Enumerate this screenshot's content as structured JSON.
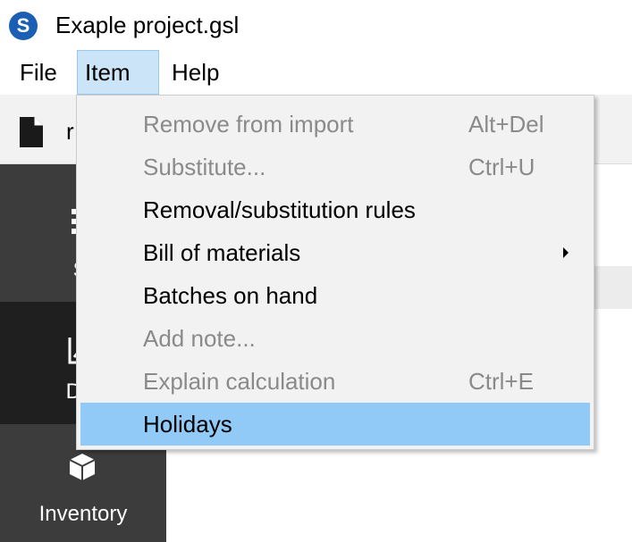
{
  "window": {
    "title": "Exaple project.gsl",
    "logo_letter": "S"
  },
  "menubar": {
    "items": [
      {
        "label": "File"
      },
      {
        "label": "Item",
        "active": true
      },
      {
        "label": "Help"
      }
    ]
  },
  "toolbar": {
    "partial_text": "r"
  },
  "sidebar": {
    "items": [
      {
        "label": "St",
        "icon": "start-icon"
      },
      {
        "label": "Der",
        "icon": "chart-icon",
        "selected": true
      },
      {
        "label": "Inventory",
        "icon": "box-icon"
      }
    ]
  },
  "dropdown": {
    "items": [
      {
        "label": "Remove from import",
        "shortcut": "Alt+Del",
        "enabled": false
      },
      {
        "label": "Substitute...",
        "shortcut": "Ctrl+U",
        "enabled": false
      },
      {
        "label": "Removal/substitution rules",
        "shortcut": "",
        "enabled": true
      },
      {
        "label": "Bill of materials",
        "shortcut": "",
        "enabled": true,
        "submenu": true
      },
      {
        "label": "Batches on hand",
        "shortcut": "",
        "enabled": true
      },
      {
        "label": "Add note...",
        "shortcut": "",
        "enabled": false
      },
      {
        "label": "Explain calculation",
        "shortcut": "Ctrl+E",
        "enabled": false
      },
      {
        "label": "Holidays",
        "shortcut": "",
        "enabled": true,
        "highlighted": true
      }
    ]
  },
  "colors": {
    "logo": "#1b5fb5",
    "menu_active_bg": "#cce4f7",
    "highlight": "#91c9f7",
    "disabled_text": "#8a8a8a",
    "sidebar_bg": "#3c3c3c",
    "sidebar_selected_bg": "#1f1f1f"
  }
}
